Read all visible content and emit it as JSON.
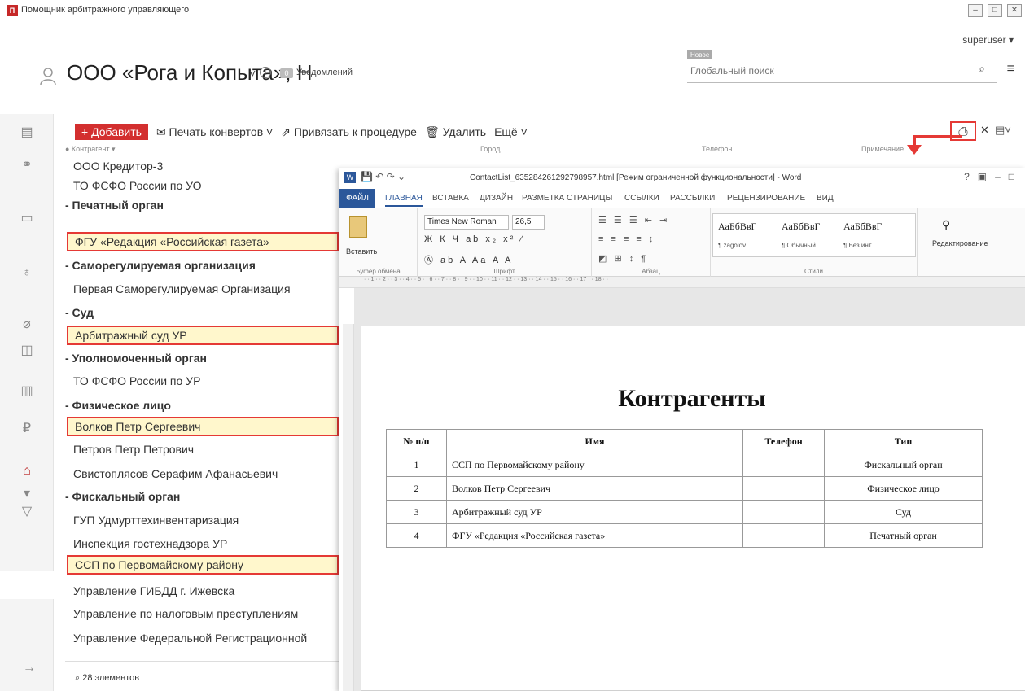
{
  "app": {
    "title": "Помощник арбитражного управляющего",
    "user": "superuser ▾"
  },
  "header": {
    "title": "ООО «Рога и Копыта», Н",
    "notifications_count": "0",
    "notifications_label": "Уведомлений",
    "search_new_badge": "Новое",
    "search_placeholder": "Глобальный поиск"
  },
  "toolbar": {
    "add_label": "+ Добавить",
    "print_envelopes_label": "✉ Печать конвертов ˅",
    "attach_label": "⇗ Привязать к процедуре",
    "delete_label": "🗑 Удалить",
    "more_label": "Ещё ˅"
  },
  "columns": {
    "contragent": "● Контрагент ▾",
    "city": "Город",
    "phone": "Телефон",
    "note": "Примечание"
  },
  "list": {
    "items": [
      {
        "text": "ООО Кредитор-3",
        "kind": "item"
      },
      {
        "text": "ТО ФСФО России по УО",
        "kind": "item"
      },
      {
        "text": "- Печатный орган",
        "kind": "group"
      },
      {
        "text": "ФГУ «Редакция «Российская газета»",
        "kind": "highlight"
      },
      {
        "text": "- Саморегулируемая организация",
        "kind": "group"
      },
      {
        "text": "Первая Саморегулируемая Организация",
        "kind": "item"
      },
      {
        "text": "- Суд",
        "kind": "group"
      },
      {
        "text": "Арбитражный суд УР",
        "kind": "highlight"
      },
      {
        "text": "- Уполномоченный орган",
        "kind": "group"
      },
      {
        "text": "ТО ФСФО России по УР",
        "kind": "item"
      },
      {
        "text": "- Физическое лицо",
        "kind": "group"
      },
      {
        "text": "Волков Петр Сергеевич",
        "kind": "highlight"
      },
      {
        "text": "Петров Петр Петрович",
        "kind": "item"
      },
      {
        "text": "Свистоплясов Серафим Афанасьевич",
        "kind": "item"
      },
      {
        "text": "- Фискальный орган",
        "kind": "group"
      },
      {
        "text": "ГУП Удмурттехинвентаризация",
        "kind": "item"
      },
      {
        "text": "Инспекция гостехнадзора УР",
        "kind": "item"
      },
      {
        "text": "ССП по Первомайскому району",
        "kind": "highlight"
      },
      {
        "text": "Управление ГИБДД г. Ижевска",
        "kind": "item"
      },
      {
        "text": "Управление по налоговым преступлениям",
        "kind": "item"
      },
      {
        "text": "Управление Федеральной Регистрационной",
        "kind": "item"
      }
    ],
    "footer": "⌕ 28 элементов"
  },
  "word": {
    "title": "ContactList_635284261292798957.html [Режим ограниченной функциональности] - Word",
    "tabs": [
      "ФАЙЛ",
      "ГЛАВНАЯ",
      "ВСТАВКА",
      "ДИЗАЙН",
      "РАЗМЕТКА СТРАНИЦЫ",
      "ССЫЛКИ",
      "РАССЫЛКИ",
      "РЕЦЕНЗИРОВАНИЕ",
      "ВИД"
    ],
    "ribbon": {
      "paste_label": "Вставить",
      "clipboard_group": "Буфер обмена",
      "font_name": "Times New Roman",
      "font_size": "26,5",
      "font_group": "Шрифт",
      "paragraph_group": "Абзац",
      "styles": [
        {
          "sample": "АаБбВвГ",
          "name": "¶ zagolov..."
        },
        {
          "sample": "АаБбВвГ",
          "name": "¶ Обычный"
        },
        {
          "sample": "АаБбВвГ",
          "name": "¶ Без инт..."
        }
      ],
      "styles_group": "Стили",
      "editing_label": "Редактирование"
    },
    "document": {
      "heading": "Контрагенты",
      "table_headers": [
        "№ п/п",
        "Имя",
        "Телефон",
        "Тип"
      ],
      "rows": [
        [
          "1",
          "ССП по Первомайскому району",
          "",
          "Фискальный орган"
        ],
        [
          "2",
          "Волков Петр Сергеевич",
          "",
          "Физическое лицо"
        ],
        [
          "3",
          "Арбитражный суд УР",
          "",
          "Суд"
        ],
        [
          "4",
          "ФГУ «Редакция «Российская газета»",
          "",
          "Печатный орган"
        ]
      ]
    }
  },
  "colors": {
    "accent_red": "#d32f2f",
    "highlight_bg": "#fff7cc",
    "word_blue": "#2b579a"
  }
}
